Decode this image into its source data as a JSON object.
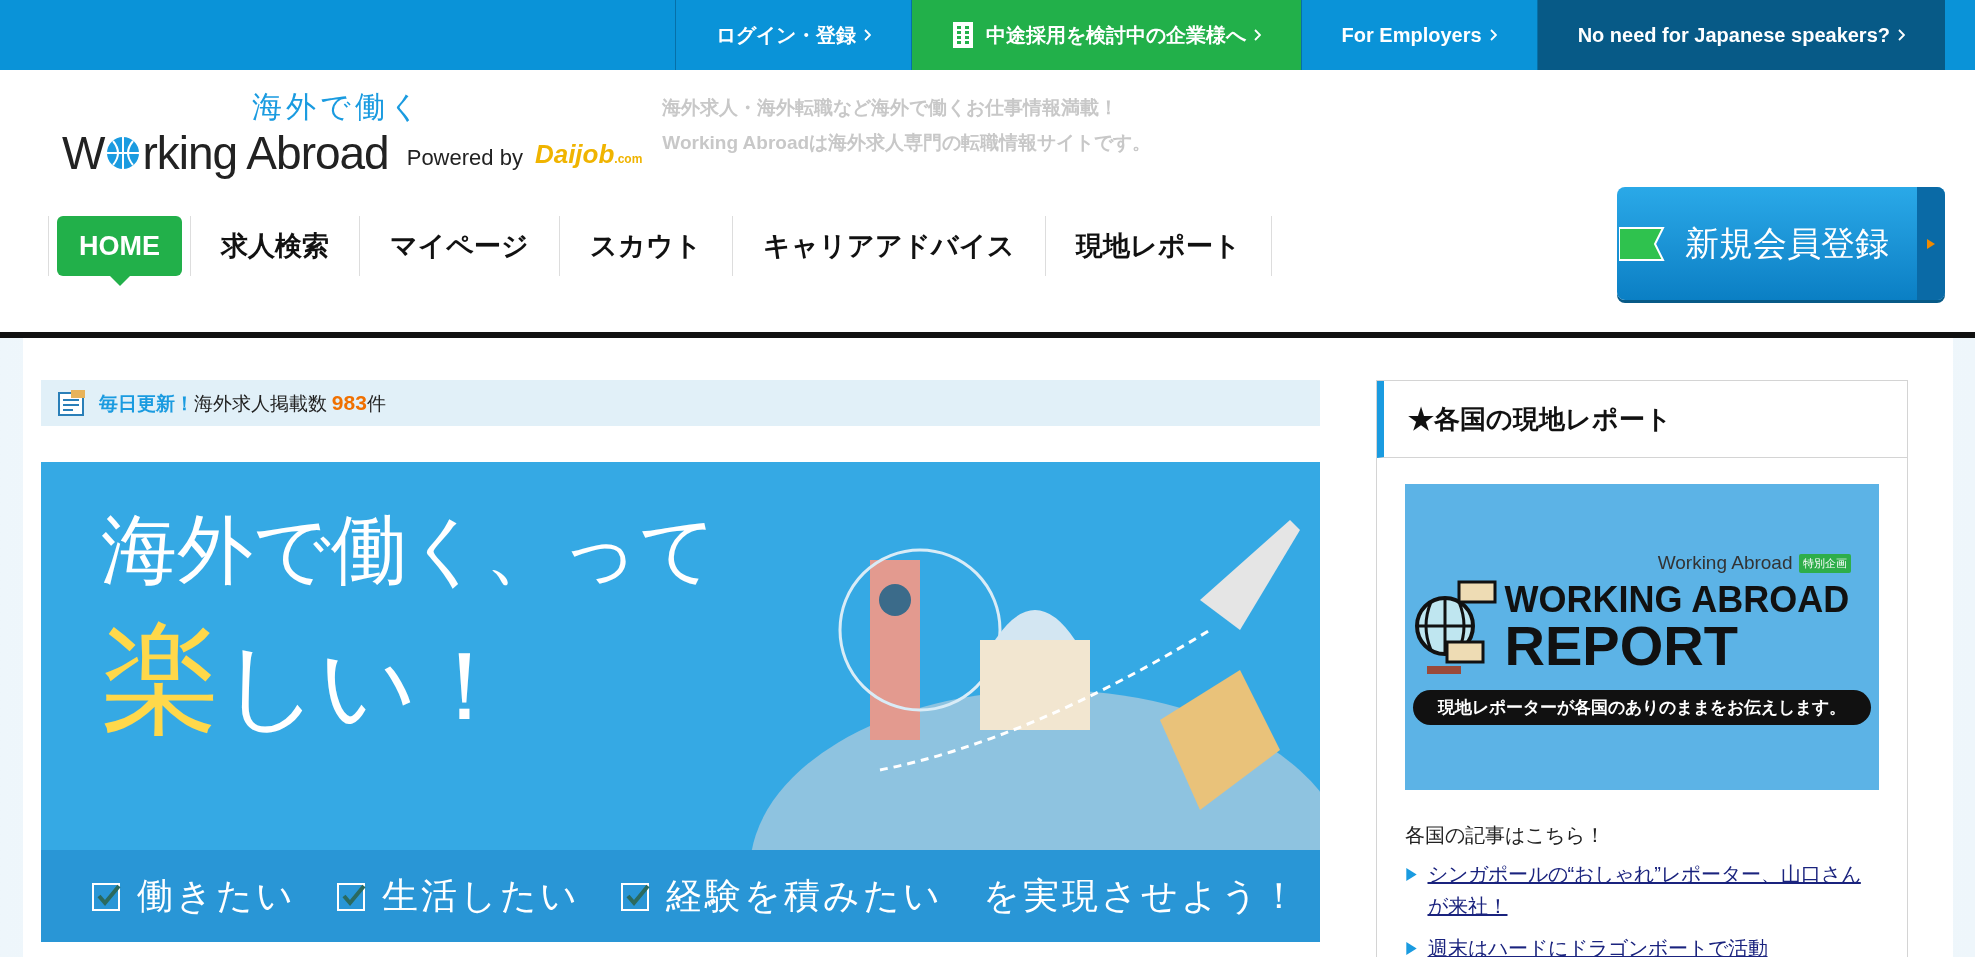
{
  "top_bar": {
    "links": [
      {
        "label": "ログイン・登録",
        "kind": "login"
      },
      {
        "label": "中途採用を検討中の企業様へ",
        "kind": "business"
      },
      {
        "label": "For Employers",
        "kind": "login"
      },
      {
        "label": "No need for Japanese speakers?",
        "kind": "dark"
      }
    ]
  },
  "header": {
    "logo": {
      "subtitle": "海外で働く",
      "name_start": "W",
      "name_end": "rking Abroad",
      "powered_by": "Powered by",
      "partner": "Daijob",
      "partner_suffix": ".com"
    },
    "tagline": [
      "海外求人・海外転職など海外で働くお仕事情報満載！",
      "Working Abroadは海外求人専門の転職情報サイトです。"
    ],
    "register_button": "新規会員登録"
  },
  "nav": [
    {
      "label": "HOME",
      "selected": true
    },
    {
      "label": "求人検索",
      "selected": false
    },
    {
      "label": "マイページ",
      "selected": false
    },
    {
      "label": "スカウト",
      "selected": false
    },
    {
      "label": "キャリアアドバイス",
      "selected": false
    },
    {
      "label": "現地レポート",
      "selected": false
    }
  ],
  "job_count": {
    "label": "毎日更新！",
    "text": "海外求人掲載数",
    "count": "983",
    "unit": "件"
  },
  "hero": {
    "line1": "海外で働く、って",
    "highlight": "楽",
    "line2_rest": "しい！",
    "checks": [
      "働きたい",
      "生活したい",
      "経験を積みたい"
    ],
    "tail": "を実現させよう！"
  },
  "sidebar": {
    "title": "★各国の現地レポート",
    "banner": {
      "brand": "Working Abroad",
      "badge": "特別企画",
      "title_line1": "WORKING ABROAD",
      "title_line2": "REPORT",
      "caption": "現地レポーターが各国のありのままをお伝えします。"
    },
    "intro": "各国の記事はこちら！",
    "links": [
      "シンガポールの“おしゃれ”レポーター、山口さんが来社！",
      "週末はハードにドラゴンボートで活動"
    ]
  }
}
